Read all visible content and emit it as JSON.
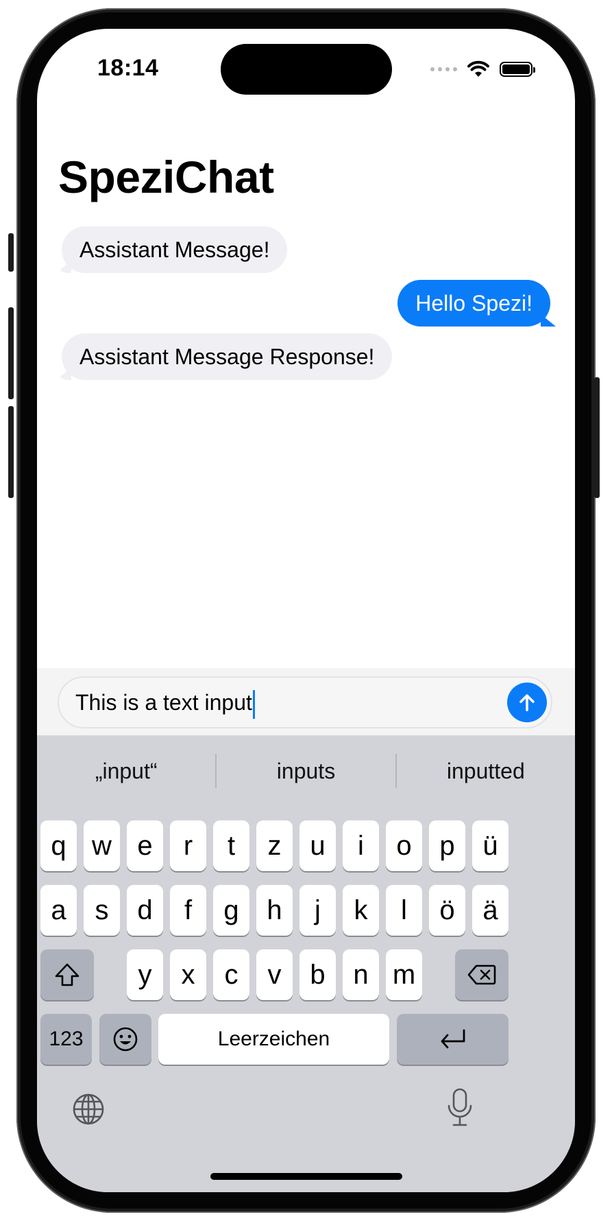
{
  "status_bar": {
    "time": "18:14",
    "wifi_icon": "wifi-icon",
    "battery_icon": "battery-icon",
    "battery_level": 1.0
  },
  "header": {
    "title": "SpeziChat"
  },
  "messages": [
    {
      "role": "assistant",
      "text": "Assistant Message!"
    },
    {
      "role": "user",
      "text": "Hello Spezi!"
    },
    {
      "role": "assistant",
      "text": "Assistant Message Response!"
    }
  ],
  "composer": {
    "value": "This is a text input",
    "send_icon": "arrow-up-icon"
  },
  "keyboard": {
    "suggestions": [
      "„input“",
      "inputs",
      "inputted"
    ],
    "row1": [
      "q",
      "w",
      "e",
      "r",
      "t",
      "z",
      "u",
      "i",
      "o",
      "p",
      "ü"
    ],
    "row2": [
      "a",
      "s",
      "d",
      "f",
      "g",
      "h",
      "j",
      "k",
      "l",
      "ö",
      "ä"
    ],
    "row3": [
      "y",
      "x",
      "c",
      "v",
      "b",
      "n",
      "m"
    ],
    "numbers_label": "123",
    "space_label": "Leerzeichen",
    "icons": {
      "shift": "shift-icon",
      "delete": "delete-icon",
      "emoji": "emoji-icon",
      "return": "return-icon",
      "globe": "globe-icon",
      "mic": "microphone-icon"
    }
  },
  "colors": {
    "accent": "#0a7cf8",
    "assistant_bubble": "#f0f0f4",
    "keyboard_bg": "#d2d3d9",
    "dark_key": "#adb1bb"
  }
}
